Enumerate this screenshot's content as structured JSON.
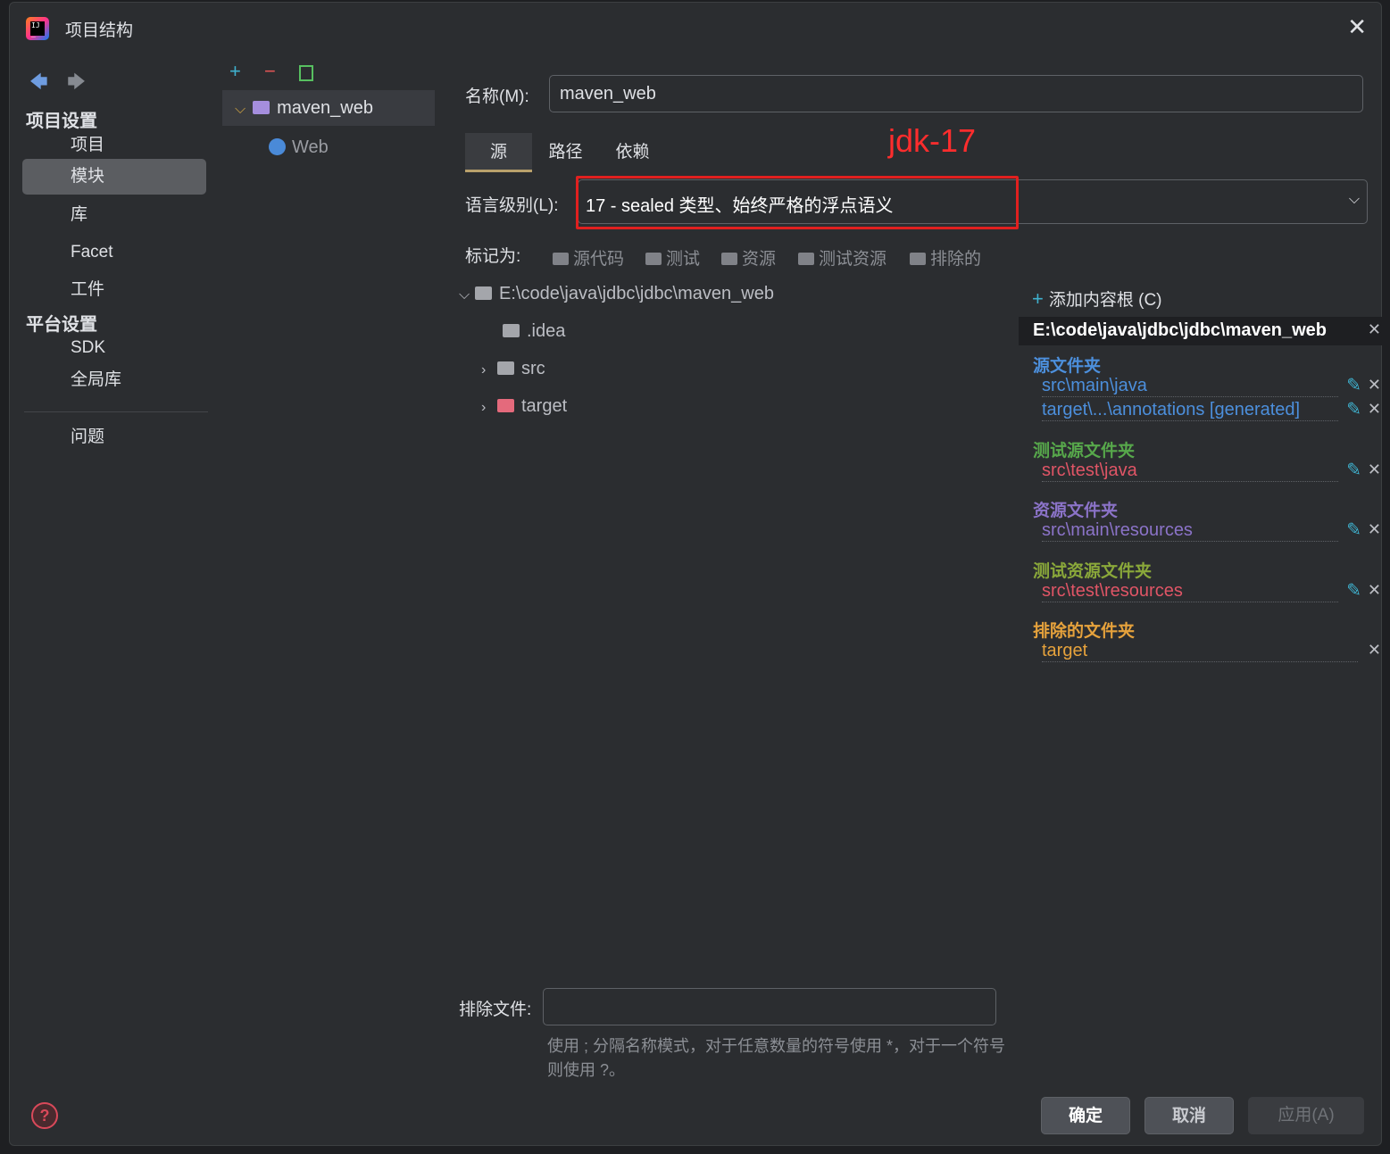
{
  "window": {
    "title": "项目结构",
    "close_icon": "✕"
  },
  "nav": {
    "back_icon": "arrow-left-icon",
    "forward_icon": "arrow-right-icon"
  },
  "sidebar": {
    "project_settings": "项目设置",
    "items": [
      {
        "label": "项目"
      },
      {
        "label": "模块",
        "selected": true
      },
      {
        "label": "库"
      },
      {
        "label": "Facet"
      },
      {
        "label": "工件"
      }
    ],
    "platform_settings": "平台设置",
    "platform_items": [
      {
        "label": "SDK"
      },
      {
        "label": "全局库"
      }
    ],
    "problems": "问题"
  },
  "module_tree": {
    "module_name": "maven_web",
    "facet": "Web"
  },
  "details": {
    "name_label": "名称(M):",
    "name_value": "maven_web",
    "tabs": [
      {
        "label": "源",
        "active": true
      },
      {
        "label": "路径"
      },
      {
        "label": "依赖"
      }
    ],
    "annotation": "jdk-17",
    "language_level_label": "语言级别(L):",
    "language_level_value": "17 - sealed 类型、始终严格的浮点语义",
    "mark_as_label": "标记为:",
    "mark_as_items": [
      "源代码",
      "测试",
      "资源",
      "测试资源",
      "排除的"
    ],
    "file_tree": {
      "root": "E:\\code\\java\\jdbc\\jdbc\\maven_web",
      "children": [
        ".idea",
        "src",
        "target"
      ]
    },
    "exclude_files_label": "排除文件:",
    "exclude_files_value": "",
    "hint": "使用 ; 分隔名称模式，对于任意数量的符号使用 *，对于一个符号则使用 ?。"
  },
  "content_roots": {
    "add_label": "添加内容根 (C)",
    "root_path": "E:\\code\\java\\jdbc\\jdbc\\maven_web",
    "source_title": "源文件夹",
    "source_entries": [
      "src\\main\\java",
      "target\\...\\annotations [generated]"
    ],
    "test_source_title": "测试源文件夹",
    "test_source_entries": [
      "src\\test\\java"
    ],
    "resource_title": "资源文件夹",
    "resource_entries": [
      "src\\main\\resources"
    ],
    "test_resource_title": "测试资源文件夹",
    "test_resource_entries": [
      "src\\test\\resources"
    ],
    "excluded_title": "排除的文件夹",
    "excluded_entries": [
      "target"
    ]
  },
  "buttons": {
    "ok": "确定",
    "cancel": "取消",
    "apply": "应用(A)"
  },
  "colors": {
    "source": "#4c8fdc",
    "test_source": "#57a84b",
    "test_entry": "#e05566",
    "resource": "#8b73c8",
    "test_resource": "#8aa83a",
    "excluded": "#e6a23c",
    "annotation_red": "#e0201f"
  }
}
